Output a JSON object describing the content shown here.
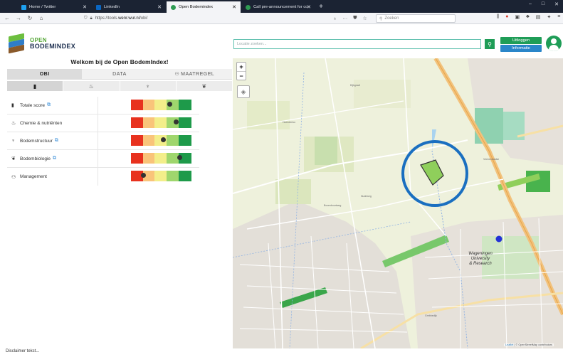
{
  "browser": {
    "tabs": [
      {
        "label": "Home / Twitter",
        "favicon_color": "#1da1f2",
        "active": false
      },
      {
        "label": "LinkedIn",
        "favicon_color": "#0a66c2",
        "active": false
      },
      {
        "label": "Open Bodemindex",
        "favicon_color": "#2e9b52",
        "active": true
      },
      {
        "label": "Call pre-announcement for co",
        "favicon_color": "#2e9b52",
        "active": false
      }
    ],
    "new_tab": "+",
    "url_prefix": "https://tools.",
    "url_domain": "wenr.wur.nl",
    "url_suffix": "/obi/",
    "search_placeholder": "Zoeken",
    "window_controls": [
      "–",
      "□",
      "✕"
    ]
  },
  "app": {
    "logo_line1": "OPEN",
    "logo_line2": "BODEMINDEX",
    "address_placeholder": "Locatie zoeken...",
    "logout_label": "Uitloggen",
    "info_label": "Informatie",
    "welcome": "Welkom bij de Open BodemIndex!",
    "main_tabs": [
      "OBI",
      "DATA",
      "MAATREGEL"
    ],
    "maatregel_icon": "binoculars-icon",
    "sub_tabs": [
      {
        "icon": "clipboard-icon",
        "glyph": "▮"
      },
      {
        "icon": "flask-icon",
        "glyph": "♨"
      },
      {
        "icon": "soil-structure-icon",
        "glyph": "♆"
      },
      {
        "icon": "leaf-icon",
        "glyph": "❦"
      }
    ],
    "scores": [
      {
        "label": "Totale score",
        "icon": "clipboard-icon",
        "glyph": "▮",
        "external_link": true,
        "score": 0.64
      },
      {
        "label": "Chemie & nutriënten",
        "icon": "flask-icon",
        "glyph": "♨",
        "external_link": false,
        "score": 0.75
      },
      {
        "label": "Bodemstructuur",
        "icon": "soil-structure-icon",
        "glyph": "♆",
        "external_link": true,
        "score": 0.54
      },
      {
        "label": "Bodembiologie",
        "icon": "leaf-icon",
        "glyph": "❦",
        "external_link": true,
        "score": 0.81
      },
      {
        "label": "Management",
        "icon": "binoculars-icon",
        "glyph": "⚇",
        "external_link": false,
        "score": 0.21
      }
    ],
    "score_colors": [
      "#e8321e",
      "#f9c47a",
      "#f3ee8a",
      "#9fd66d",
      "#1e9a4a"
    ],
    "disclaimer": "Disclaimer tekst..."
  },
  "map": {
    "zoom_in": "+",
    "zoom_out": "−",
    "place_label_line1": "Wageningen",
    "place_label_line2": "University",
    "place_label_line3": "& Research",
    "street_labels": [
      "Hoenderloo",
      "Dijkgraaf",
      "Nudeweg",
      "Veenendaalse",
      "Bovenbuurtweg",
      "Grebbedijk"
    ],
    "attribution_prefix": "Leaflet",
    "attribution_text": " | © OpenStreetMap contributors",
    "highlight_color": "#1a6fc0",
    "parcel_color": "#8fcf5b"
  }
}
